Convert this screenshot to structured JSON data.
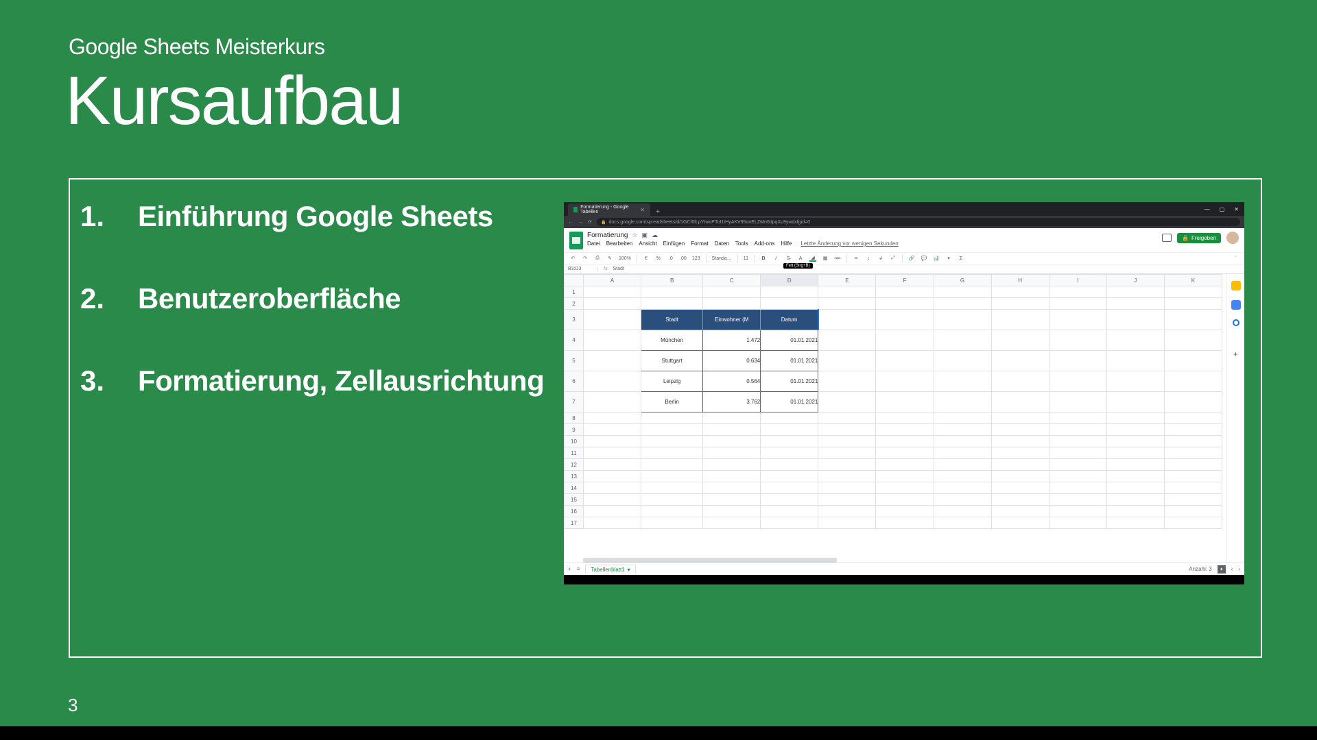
{
  "slide": {
    "subtitle": "Google Sheets Meisterkurs",
    "title": "Kursaufbau",
    "page_number": "3"
  },
  "toc": [
    {
      "num": "1.",
      "text": "Einführung Google Sheets"
    },
    {
      "num": "2.",
      "text": "Benutzeroberfläche"
    },
    {
      "num": "3.",
      "text": "Formatierung, Zellausrichtung"
    }
  ],
  "screenshot": {
    "browser": {
      "tab_title": "Formatierung - Google Tabellen",
      "url": "docs.google.com/spreadsheets/d/1GCf0lLpYtwoPToI1tHyAKV95onELZMn0dpqXu9ywdxfgid=0",
      "win_min": "—",
      "win_max": "▢",
      "win_close": "✕"
    },
    "sheets": {
      "doc_title": "Formatierung",
      "menus": [
        "Datei",
        "Bearbeiten",
        "Ansicht",
        "Einfügen",
        "Format",
        "Daten",
        "Tools",
        "Add-ons",
        "Hilfe"
      ],
      "save_msg": "Letzte Änderung vor wenigen Sekunden",
      "share_label": "Freigeben",
      "zoom": "100%",
      "currency": "€",
      "percent": "%",
      "dec_dec": ".0",
      "dec_inc": ".00",
      "fmt123": "123",
      "font": "Standa…",
      "font_size": "11",
      "tooltip": "Fett (Strg+B)",
      "name_box": "B3:D3",
      "fx_content": "Stadt",
      "columns": [
        "A",
        "B",
        "C",
        "D",
        "E",
        "F",
        "G",
        "H",
        "I",
        "J",
        "K"
      ],
      "rows": [
        "1",
        "2",
        "3",
        "4",
        "5",
        "6",
        "7",
        "8",
        "9",
        "10",
        "11",
        "12",
        "13",
        "14",
        "15",
        "16",
        "17"
      ],
      "table": {
        "headers": [
          "Stadt",
          "Einwohner (M",
          "Datum"
        ],
        "rows": [
          {
            "city": "München",
            "pop": "1.472",
            "date": "01.01.2021"
          },
          {
            "city": "Stuttgart",
            "pop": "0.634",
            "date": "01.01.2021"
          },
          {
            "city": "Leipzig",
            "pop": "0.564",
            "date": "01.01.2021"
          },
          {
            "city": "Berlin",
            "pop": "3.762",
            "date": "01.01.2021"
          }
        ]
      },
      "sheet_tab": "Tabellenblatt1",
      "count_label": "Anzahl: 3"
    }
  }
}
